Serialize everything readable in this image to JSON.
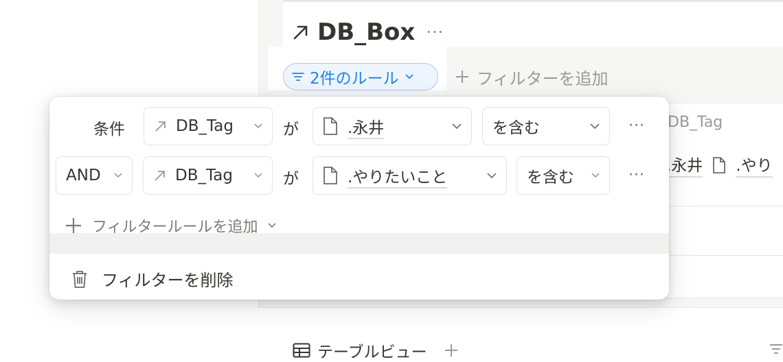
{
  "page": {
    "title": "DB_Box",
    "title_more": "···"
  },
  "filter_bar": {
    "active_pill": "2件のルール",
    "add_filter": "フィルターを追加"
  },
  "background": {
    "property_label": "DB_Tag",
    "tags": [
      ".永井",
      ".やり"
    ],
    "view_tab": "テーブルビュー"
  },
  "filter_popup": {
    "rules": [
      {
        "prefix": "条件",
        "property": "DB_Tag",
        "connector": "が",
        "value": ".永井",
        "operator": "を含む",
        "more": "···"
      },
      {
        "prefix": "AND",
        "property": "DB_Tag",
        "connector": "が",
        "value": ".やりたいこと",
        "operator": "を含む",
        "more": "···"
      }
    ],
    "add_rule": "フィルタールールを追加",
    "delete_filter": "フィルターを削除"
  },
  "colors": {
    "accent": "#2383e2",
    "text": "#37352f",
    "muted": "#9b9a97"
  }
}
